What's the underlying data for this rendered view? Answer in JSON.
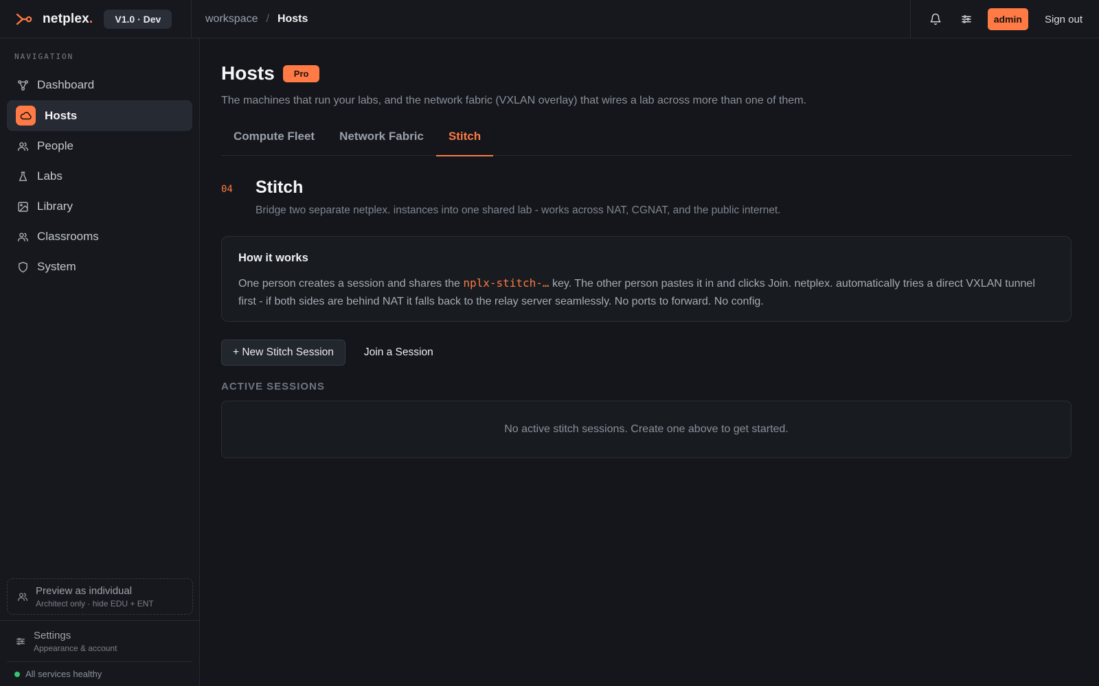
{
  "brand": {
    "name": "netplex",
    "dot": ".",
    "version": "V1.0 · Dev",
    "accent": "#ff7a45"
  },
  "breadcrumb": {
    "root": "workspace",
    "separator": "/",
    "current": "Hosts"
  },
  "topbar": {
    "bell_icon": "bell-icon",
    "sliders_icon": "sliders-icon",
    "user_badge": "admin",
    "signout": "Sign out"
  },
  "sidebar": {
    "heading": "NAVIGATION",
    "items": [
      {
        "label": "Dashboard",
        "icon": "topology-icon",
        "active": false
      },
      {
        "label": "Hosts",
        "icon": "cloud-icon",
        "active": true
      },
      {
        "label": "People",
        "icon": "people-icon",
        "active": false
      },
      {
        "label": "Labs",
        "icon": "flask-icon",
        "active": false
      },
      {
        "label": "Library",
        "icon": "image-icon",
        "active": false
      },
      {
        "label": "Classrooms",
        "icon": "people-icon",
        "active": false
      },
      {
        "label": "System",
        "icon": "shield-icon",
        "active": false
      }
    ],
    "preview": {
      "title": "Preview as individual",
      "subtitle": "Architect only · hide EDU + ENT"
    },
    "settings": {
      "title": "Settings",
      "subtitle": "Appearance & account"
    },
    "status": {
      "text": "All services healthy",
      "color": "#34c66e"
    }
  },
  "page": {
    "title": "Hosts",
    "badge": "Pro",
    "description": "The machines that run your labs, and the network fabric (VXLAN overlay) that wires a lab across more than one of them."
  },
  "tabs": [
    {
      "label": "Compute Fleet",
      "active": false
    },
    {
      "label": "Network Fabric",
      "active": false
    },
    {
      "label": "Stitch",
      "active": true
    }
  ],
  "section": {
    "number": "04",
    "title": "Stitch",
    "description": "Bridge two separate netplex. instances into one shared lab - works across NAT, CGNAT, and the public internet."
  },
  "how_it_works": {
    "title": "How it works",
    "body_before": "One person creates a session and shares the ",
    "key": "nplx-stitch-…",
    "body_after": " key. The other person pastes it in and clicks Join. netplex. automatically tries a direct VXLAN tunnel first - if both sides are behind NAT it falls back to the relay server seamlessly. No ports to forward. No config."
  },
  "actions": {
    "new_session": "+ New Stitch Session",
    "join_session": "Join a Session"
  },
  "active_sessions": {
    "heading": "ACTIVE SESSIONS",
    "empty_message": "No active stitch sessions. Create one above to get started."
  }
}
